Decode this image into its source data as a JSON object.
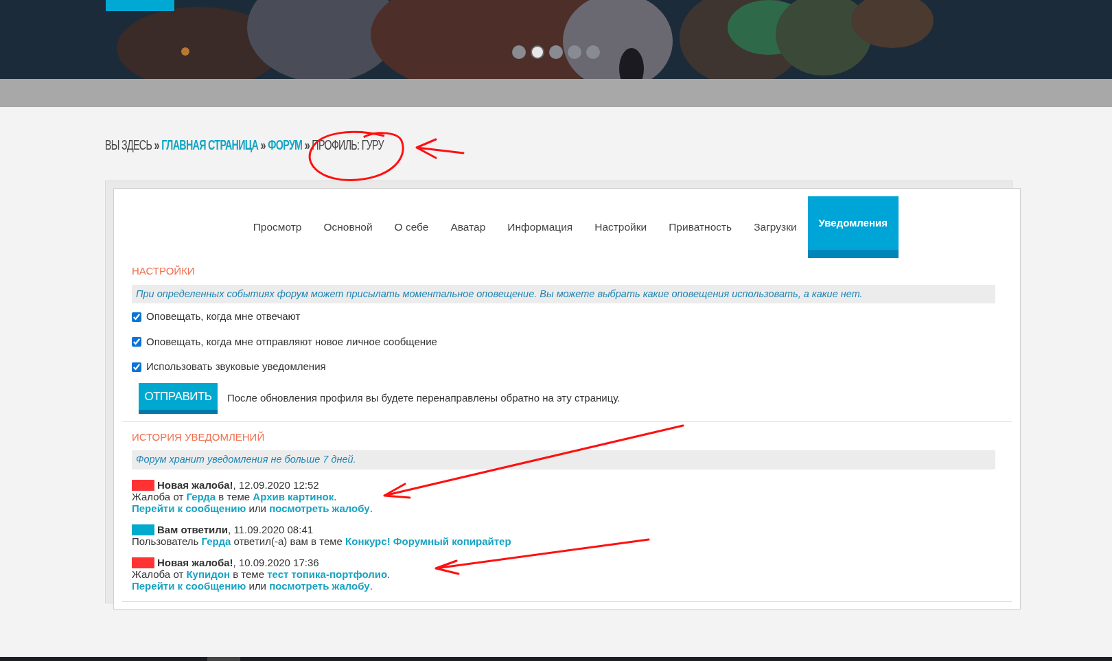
{
  "slider": {
    "dots": [
      {
        "selected": false
      },
      {
        "selected": true
      },
      {
        "selected": false
      },
      {
        "selected": false
      },
      {
        "selected": false
      }
    ]
  },
  "breadcrumb": {
    "prefix": "ВЫ ЗДЕСЬ",
    "separator": "»",
    "items": [
      {
        "label": "ГЛАВНАЯ СТРАНИЦА",
        "link": true
      },
      {
        "label": "ФОРУМ",
        "link": true
      },
      {
        "label": "ПРОФИЛЬ: ГУРУ",
        "link": false
      }
    ]
  },
  "tabs": [
    {
      "label": "Просмотр",
      "selected": false
    },
    {
      "label": "Основной",
      "selected": false
    },
    {
      "label": "О себе",
      "selected": false
    },
    {
      "label": "Аватар",
      "selected": false
    },
    {
      "label": "Информация",
      "selected": false
    },
    {
      "label": "Настройки",
      "selected": false
    },
    {
      "label": "Приватность",
      "selected": false
    },
    {
      "label": "Загрузки",
      "selected": false
    },
    {
      "label": "Уведомления",
      "selected": true
    }
  ],
  "settings": {
    "title": "НАСТРОЙКИ",
    "info": "При определенных событиях форум может присылать моментальное оповещение. Вы можете выбрать какие оповещения использовать, а какие нет.",
    "options": [
      {
        "label": "Оповещать, когда мне отвечают",
        "checked": true
      },
      {
        "label": "Оповещать, когда мне отправляют новое личное сообщение",
        "checked": true
      },
      {
        "label": "Использовать звуковые уведомления",
        "checked": true
      }
    ],
    "submit": "ОТПРАВИТЬ",
    "note": "После обновления профиля вы будете перенаправлены обратно на эту страницу."
  },
  "history": {
    "title": "ИСТОРИЯ УВЕДОМЛЕНИЙ",
    "info": "Форум хранит уведомления не больше 7 дней.",
    "entries": [
      {
        "color": "#ff3333",
        "title": "Новая жалоба!",
        "date": ", 12.09.2020 12:52",
        "lines": [
          [
            {
              "text": "Жалоба от "
            },
            {
              "text": "Герда",
              "link": true
            },
            {
              "text": " в теме "
            },
            {
              "text": "Архив картинок",
              "link": true
            },
            {
              "text": "."
            }
          ],
          [
            {
              "text": "Перейти к сообщению",
              "link": true
            },
            {
              "text": " или "
            },
            {
              "text": "посмотреть жалобу",
              "link": true
            },
            {
              "text": "."
            }
          ]
        ]
      },
      {
        "color": "#00aacc",
        "title": "Вам ответили",
        "date": ", 11.09.2020 08:41",
        "lines": [
          [
            {
              "text": "Пользователь "
            },
            {
              "text": "Герда",
              "link": true
            },
            {
              "text": " ответил(-а) вам в теме "
            },
            {
              "text": "Конкурс! Форумный копирайтер",
              "link": true
            }
          ]
        ]
      },
      {
        "color": "#ff3333",
        "title": "Новая жалоба!",
        "date": ", 10.09.2020 17:36",
        "lines": [
          [
            {
              "text": "Жалоба от "
            },
            {
              "text": "Купидон",
              "link": true
            },
            {
              "text": " в теме "
            },
            {
              "text": "тест топика-портфолио",
              "link": true
            },
            {
              "text": "."
            }
          ],
          [
            {
              "text": "Перейти к сообщению",
              "link": true
            },
            {
              "text": " или "
            },
            {
              "text": "посмотреть жалобу",
              "link": true
            },
            {
              "text": "."
            }
          ]
        ]
      }
    ]
  }
}
